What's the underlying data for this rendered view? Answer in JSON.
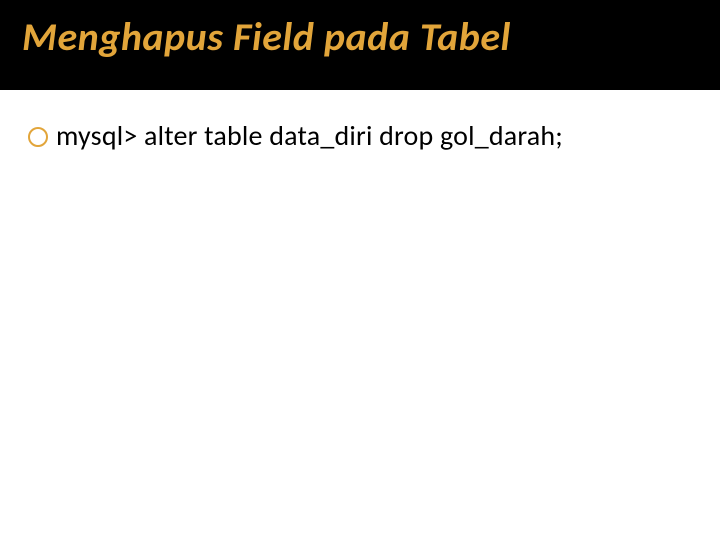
{
  "slide": {
    "title": "Menghapus Field pada Tabel",
    "body": {
      "bullets": [
        {
          "text": "mysql> alter table data_diri drop gol_darah;"
        }
      ]
    }
  }
}
